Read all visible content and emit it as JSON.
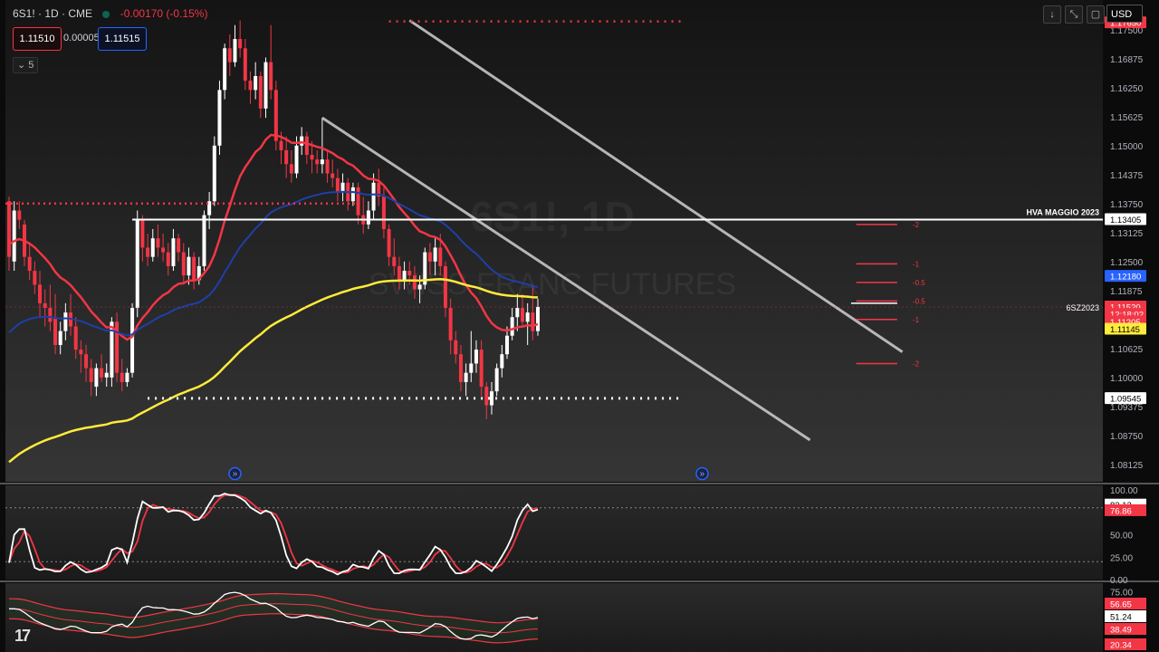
{
  "header": {
    "symbol": "6S1! · 1D · CME",
    "change": "-0.00170 (-0.15%)",
    "sell_price": "1.11510",
    "spread": "0.00005",
    "buy_price": "1.11515",
    "indicator_count": "5",
    "currency": "USD"
  },
  "toolbar": {
    "down_icon": "arrow-down-icon",
    "fullscreen_icon": "collapse-icon",
    "screenshot_icon": "frame-icon"
  },
  "watermark": {
    "line1": "6S1!, 1D",
    "line2": "SWISS FRANC FUTURES"
  },
  "price_axis": {
    "ticks": [
      "1.17500",
      "1.16875",
      "1.16250",
      "1.15625",
      "1.15000",
      "1.14375",
      "1.13750",
      "1.13125",
      "1.12500",
      "1.11875",
      "1.10625",
      "1.10000",
      "1.09375",
      "1.08750",
      "1.08125"
    ],
    "labels": [
      {
        "text": "1.17650",
        "bg": "#f23645",
        "fg": "#ffffff",
        "value": 1.1765
      },
      {
        "text": "1.13405",
        "bg": "#ffffff",
        "fg": "#000000",
        "value": 1.13405
      },
      {
        "text": "1.12180",
        "bg": "#2962ff",
        "fg": "#ffffff",
        "value": 1.1218
      },
      {
        "text": "1.11520",
        "bg": "#f23645",
        "fg": "#ffffff",
        "value": 1.1152
      },
      {
        "text": "12:18:02",
        "bg": "#f23645",
        "fg": "#ffffff",
        "value": 1.1136
      },
      {
        "text": "1.11205",
        "bg": "#f23645",
        "fg": "#ffffff",
        "value": 1.112
      },
      {
        "text": "1.11145",
        "bg": "#ffeb3b",
        "fg": "#000000",
        "value": 1.1104
      },
      {
        "text": "1.09545",
        "bg": "#ffffff",
        "fg": "#000000",
        "value": 1.09545
      }
    ]
  },
  "annotations": {
    "hva_label": "HVA MAGGIO 2023",
    "contract_label": "6SZ2023",
    "fib_levels": [
      {
        "label": "-2",
        "value": 1.133
      },
      {
        "label": "-1",
        "value": 1.1245
      },
      {
        "label": "-0.5",
        "value": 1.1205
      },
      {
        "label": "-0.5",
        "value": 1.1165
      },
      {
        "label": "-1",
        "value": 1.1125
      },
      {
        "label": "-2",
        "value": 1.103
      }
    ]
  },
  "oscillator1": {
    "ticks": [
      "100.00",
      "50.00",
      "25.00",
      "0.00"
    ],
    "value_white": "83.12",
    "value_red": "76.86"
  },
  "oscillator2": {
    "ticks": [
      "75.00"
    ],
    "values": [
      "56.65",
      "51.24",
      "38.49",
      "20.34"
    ]
  },
  "colors": {
    "up": "#ffffff",
    "down": "#f23645",
    "ema_fast": "#f23645",
    "ema_mid": "#1f3fa8",
    "ema_slow": "#ffeb3b",
    "channel": "#d0d0d0"
  },
  "chart_data": {
    "type": "candlestick",
    "title": "6S1! · 1D · CME",
    "price_range": [
      1.0775,
      1.1775
    ],
    "ohlc": [
      [
        1.138,
        1.139,
        1.123,
        1.126
      ],
      [
        1.125,
        1.138,
        1.123,
        1.136
      ],
      [
        1.136,
        1.138,
        1.132,
        1.134
      ],
      [
        1.133,
        1.134,
        1.124,
        1.126
      ],
      [
        1.126,
        1.129,
        1.121,
        1.123
      ],
      [
        1.123,
        1.125,
        1.118,
        1.12
      ],
      [
        1.12,
        1.123,
        1.113,
        1.116
      ],
      [
        1.116,
        1.119,
        1.111,
        1.115
      ],
      [
        1.115,
        1.12,
        1.11,
        1.112
      ],
      [
        1.113,
        1.118,
        1.105,
        1.107
      ],
      [
        1.107,
        1.112,
        1.105,
        1.11
      ],
      [
        1.11,
        1.116,
        1.108,
        1.114
      ],
      [
        1.114,
        1.118,
        1.109,
        1.111
      ],
      [
        1.111,
        1.113,
        1.104,
        1.106
      ],
      [
        1.106,
        1.108,
        1.101,
        1.105
      ],
      [
        1.105,
        1.107,
        1.099,
        1.102
      ],
      [
        1.102,
        1.104,
        1.096,
        1.099
      ],
      [
        1.098,
        1.103,
        1.096,
        1.102
      ],
      [
        1.102,
        1.105,
        1.099,
        1.1
      ],
      [
        1.1,
        1.103,
        1.098,
        1.101
      ],
      [
        1.1,
        1.113,
        1.098,
        1.112
      ],
      [
        1.112,
        1.114,
        1.099,
        1.101
      ],
      [
        1.101,
        1.104,
        1.097,
        1.099
      ],
      [
        1.099,
        1.102,
        1.098,
        1.101
      ],
      [
        1.101,
        1.116,
        1.1,
        1.115
      ],
      [
        1.115,
        1.136,
        1.113,
        1.134
      ],
      [
        1.134,
        1.135,
        1.125,
        1.128
      ],
      [
        1.128,
        1.131,
        1.124,
        1.126
      ],
      [
        1.126,
        1.132,
        1.125,
        1.13
      ],
      [
        1.13,
        1.133,
        1.126,
        1.128
      ],
      [
        1.128,
        1.131,
        1.125,
        1.127
      ],
      [
        1.127,
        1.129,
        1.122,
        1.124
      ],
      [
        1.124,
        1.132,
        1.123,
        1.13
      ],
      [
        1.13,
        1.131,
        1.125,
        1.127
      ],
      [
        1.127,
        1.129,
        1.12,
        1.122
      ],
      [
        1.122,
        1.128,
        1.12,
        1.126
      ],
      [
        1.126,
        1.127,
        1.119,
        1.121
      ],
      [
        1.121,
        1.126,
        1.12,
        1.124
      ],
      [
        1.124,
        1.136,
        1.123,
        1.135
      ],
      [
        1.135,
        1.14,
        1.132,
        1.138
      ],
      [
        1.138,
        1.152,
        1.137,
        1.15
      ],
      [
        1.15,
        1.164,
        1.148,
        1.162
      ],
      [
        1.162,
        1.172,
        1.16,
        1.171
      ],
      [
        1.171,
        1.174,
        1.165,
        1.168
      ],
      [
        1.168,
        1.176,
        1.167,
        1.173
      ],
      [
        1.173,
        1.177,
        1.169,
        1.171
      ],
      [
        1.171,
        1.173,
        1.162,
        1.164
      ],
      [
        1.164,
        1.166,
        1.159,
        1.162
      ],
      [
        1.162,
        1.168,
        1.16,
        1.165
      ],
      [
        1.165,
        1.166,
        1.156,
        1.158
      ],
      [
        1.158,
        1.169,
        1.156,
        1.168
      ],
      [
        1.168,
        1.176,
        1.16,
        1.162
      ],
      [
        1.162,
        1.164,
        1.149,
        1.151
      ],
      [
        1.151,
        1.153,
        1.146,
        1.149
      ],
      [
        1.149,
        1.152,
        1.143,
        1.146
      ],
      [
        1.146,
        1.149,
        1.142,
        1.144
      ],
      [
        1.144,
        1.152,
        1.143,
        1.15
      ],
      [
        1.15,
        1.154,
        1.148,
        1.152
      ],
      [
        1.152,
        1.153,
        1.146,
        1.148
      ],
      [
        1.148,
        1.151,
        1.144,
        1.147
      ],
      [
        1.147,
        1.149,
        1.144,
        1.146
      ],
      [
        1.146,
        1.156,
        1.144,
        1.147
      ],
      [
        1.147,
        1.149,
        1.142,
        1.144
      ],
      [
        1.144,
        1.147,
        1.141,
        1.143
      ],
      [
        1.143,
        1.145,
        1.138,
        1.14
      ],
      [
        1.14,
        1.144,
        1.138,
        1.142
      ],
      [
        1.142,
        1.143,
        1.136,
        1.138
      ],
      [
        1.138,
        1.142,
        1.137,
        1.141
      ],
      [
        1.141,
        1.142,
        1.133,
        1.135
      ],
      [
        1.135,
        1.139,
        1.131,
        1.133
      ],
      [
        1.133,
        1.138,
        1.132,
        1.136
      ],
      [
        1.136,
        1.144,
        1.134,
        1.142
      ],
      [
        1.142,
        1.145,
        1.137,
        1.139
      ],
      [
        1.139,
        1.141,
        1.13,
        1.132
      ],
      [
        1.132,
        1.133,
        1.124,
        1.126
      ],
      [
        1.126,
        1.13,
        1.122,
        1.124
      ],
      [
        1.124,
        1.126,
        1.119,
        1.121
      ],
      [
        1.121,
        1.125,
        1.119,
        1.123
      ],
      [
        1.123,
        1.125,
        1.12,
        1.122
      ],
      [
        1.122,
        1.124,
        1.117,
        1.119
      ],
      [
        1.119,
        1.122,
        1.116,
        1.12
      ],
      [
        1.12,
        1.128,
        1.119,
        1.127
      ],
      [
        1.127,
        1.129,
        1.122,
        1.125
      ],
      [
        1.125,
        1.13,
        1.122,
        1.128
      ],
      [
        1.128,
        1.131,
        1.122,
        1.124
      ],
      [
        1.124,
        1.125,
        1.113,
        1.115
      ],
      [
        1.115,
        1.117,
        1.105,
        1.108
      ],
      [
        1.108,
        1.11,
        1.103,
        1.105
      ],
      [
        1.105,
        1.107,
        1.097,
        1.099
      ],
      [
        1.099,
        1.103,
        1.096,
        1.101
      ],
      [
        1.101,
        1.11,
        1.099,
        1.103
      ],
      [
        1.103,
        1.108,
        1.101,
        1.106
      ],
      [
        1.106,
        1.108,
        1.096,
        1.098
      ],
      [
        1.098,
        1.099,
        1.091,
        1.094
      ],
      [
        1.094,
        1.099,
        1.092,
        1.097
      ],
      [
        1.097,
        1.103,
        1.096,
        1.102
      ],
      [
        1.102,
        1.107,
        1.1,
        1.105
      ],
      [
        1.105,
        1.111,
        1.104,
        1.109
      ],
      [
        1.109,
        1.115,
        1.108,
        1.113
      ],
      [
        1.113,
        1.118,
        1.11,
        1.115
      ],
      [
        1.115,
        1.118,
        1.111,
        1.112
      ],
      [
        1.112,
        1.116,
        1.107,
        1.114
      ],
      [
        1.114,
        1.12,
        1.108,
        1.11
      ],
      [
        1.11,
        1.117,
        1.109,
        1.1152
      ]
    ]
  }
}
